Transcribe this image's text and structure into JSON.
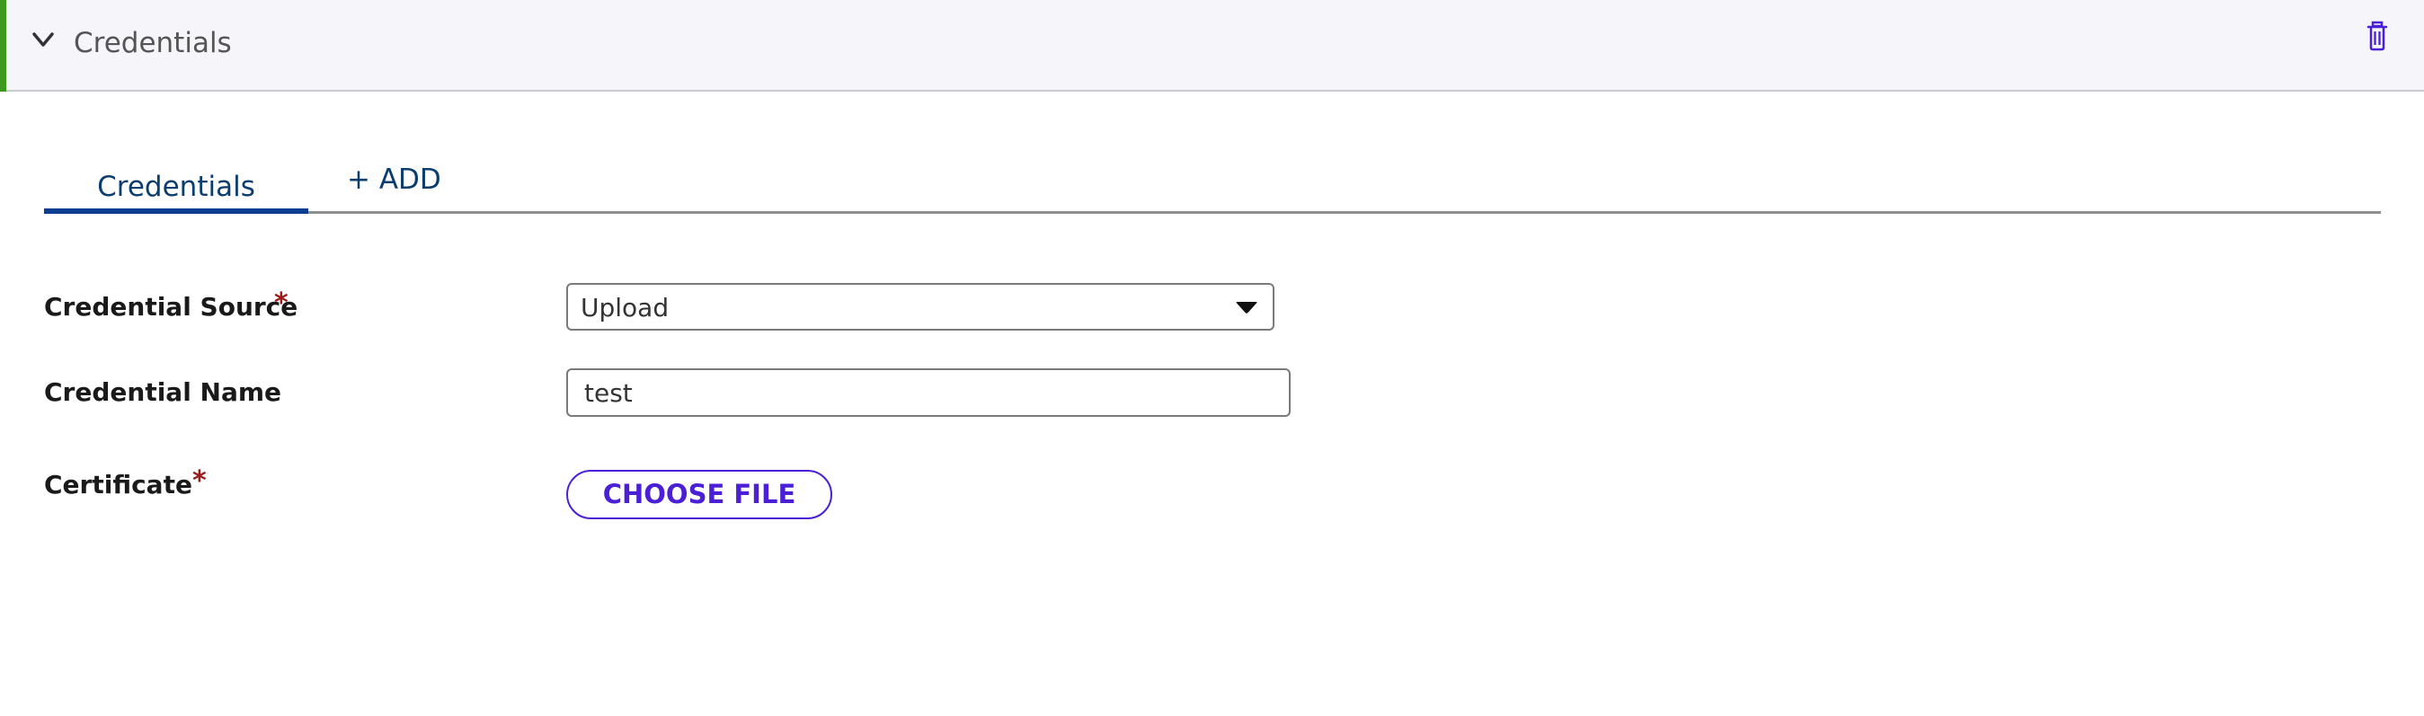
{
  "section": {
    "title": "Credentials",
    "accent_color": "#3e9a1e",
    "collapse_icon": "chevron-down-icon",
    "delete_icon": "trash-icon"
  },
  "tabs": {
    "items": [
      {
        "label": "Credentials",
        "active": true
      },
      {
        "label": "+ ADD",
        "active": false
      }
    ]
  },
  "form": {
    "credential_source": {
      "label": "Credential Source",
      "required_mark": "*",
      "value": "Upload"
    },
    "credential_name": {
      "label": "Credential Name",
      "value": "test"
    },
    "certificate": {
      "label": "Certificate",
      "required_mark": "*",
      "button_label": "CHOOSE FILE"
    }
  },
  "colors": {
    "primary_text": "#0b3d6e",
    "button_accent": "#4a1fd6",
    "required": "#9b1b1b"
  }
}
